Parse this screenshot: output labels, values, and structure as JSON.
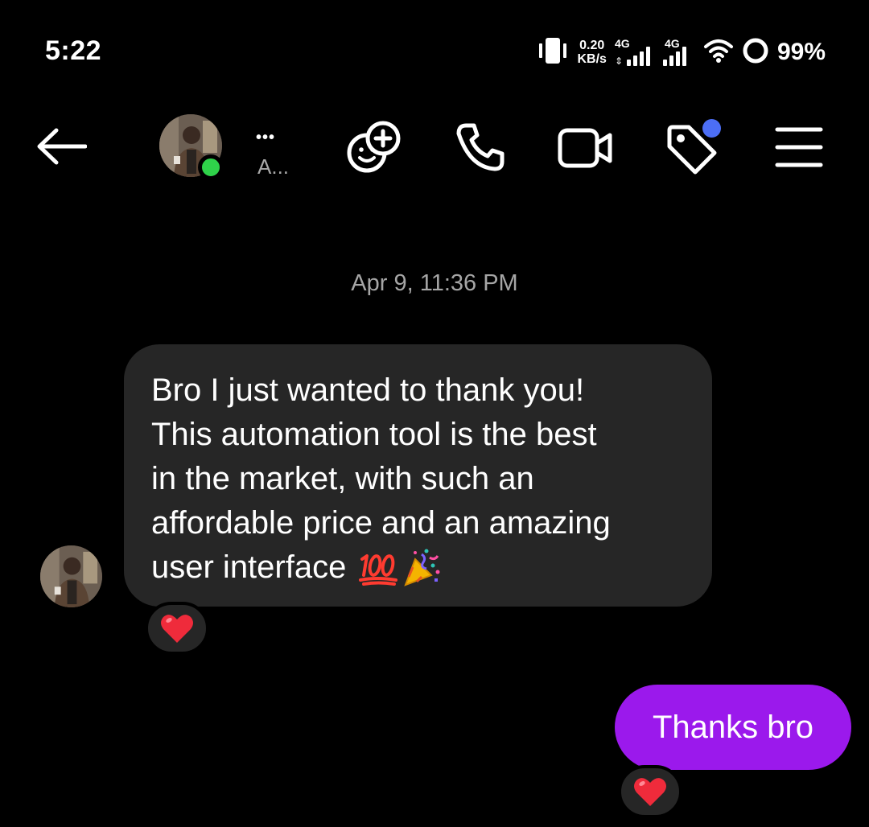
{
  "status_bar": {
    "time": "5:22",
    "net_speed_value": "0.20",
    "net_speed_unit": "KB/s",
    "sim1_type": "4G",
    "sim2_type": "4G",
    "battery": "99%"
  },
  "header": {
    "contact_name": "•••",
    "contact_sub": "A...",
    "online_color": "#2fd24a",
    "notification_color": "#4c6ef5"
  },
  "conversation": {
    "date_separator": "Apr 9, 11:36 PM",
    "incoming_message": {
      "line1": "Bro I just wanted to thank you!",
      "line2": "This automation tool is the best",
      "line3": "in the market, with such an",
      "line4": "affordable price and an amazing",
      "line5": "user interface",
      "emoji_1": "hundred-points-emoji",
      "emoji_2": "party-popper-emoji",
      "reaction": "heart"
    },
    "outgoing_message": {
      "text": "Thanks bro",
      "reaction": "heart",
      "bubble_color": "#9b19ec"
    }
  }
}
